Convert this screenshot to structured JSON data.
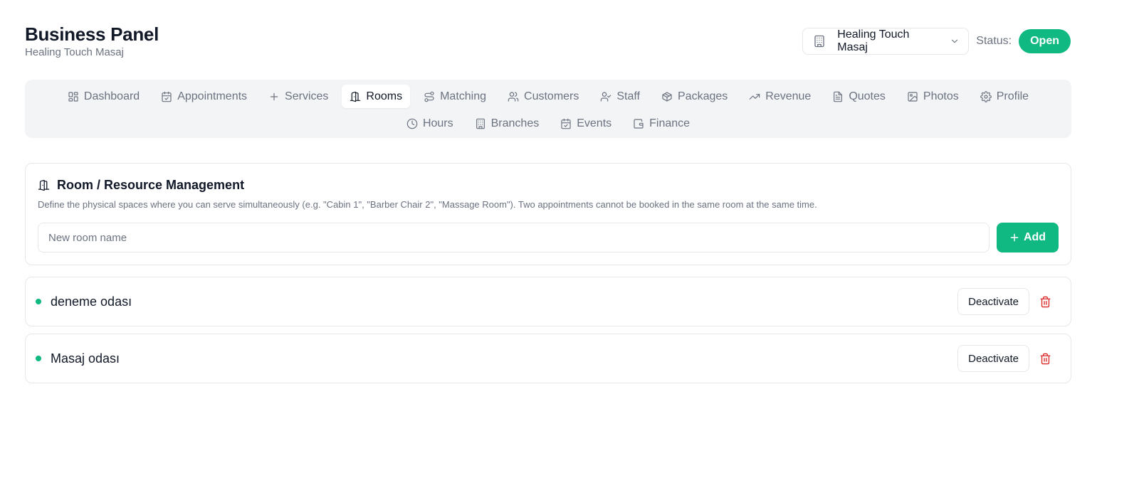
{
  "header": {
    "title": "Business Panel",
    "subtitle": "Healing Touch Masaj",
    "business_select": {
      "value": "Healing Touch Masaj",
      "icon": "building-icon"
    },
    "status_label": "Status:",
    "status_value": "Open",
    "status_color": "#10b981"
  },
  "nav": {
    "row1": [
      {
        "label": "Dashboard",
        "icon": "dashboard-icon"
      },
      {
        "label": "Appointments",
        "icon": "calendar-check-icon"
      },
      {
        "label": "Services",
        "icon": "plus-icon"
      },
      {
        "label": "Rooms",
        "icon": "door-icon",
        "active": true
      },
      {
        "label": "Matching",
        "icon": "route-icon"
      },
      {
        "label": "Customers",
        "icon": "users-icon"
      },
      {
        "label": "Staff",
        "icon": "user-check-icon"
      },
      {
        "label": "Packages",
        "icon": "package-icon"
      },
      {
        "label": "Revenue",
        "icon": "trending-up-icon"
      },
      {
        "label": "Quotes",
        "icon": "file-icon"
      },
      {
        "label": "Photos",
        "icon": "image-icon"
      },
      {
        "label": "Profile",
        "icon": "gear-icon"
      }
    ],
    "row2": [
      {
        "label": "Hours",
        "icon": "clock-icon"
      },
      {
        "label": "Branches",
        "icon": "building-icon"
      },
      {
        "label": "Events",
        "icon": "calendar-check-icon"
      },
      {
        "label": "Finance",
        "icon": "wallet-icon"
      }
    ]
  },
  "management": {
    "title": "Room / Resource Management",
    "description": "Define the physical spaces where you can serve simultaneously (e.g. \"Cabin 1\", \"Barber Chair 2\", \"Massage Room\"). Two appointments cannot be booked in the same room at the same time.",
    "input_placeholder": "New room name",
    "input_value": "",
    "add_label": "Add"
  },
  "rooms": [
    {
      "name": "deneme odası",
      "action_label": "Deactivate",
      "status_color": "#10b981"
    },
    {
      "name": "Masaj odası",
      "action_label": "Deactivate",
      "status_color": "#10b981"
    }
  ]
}
